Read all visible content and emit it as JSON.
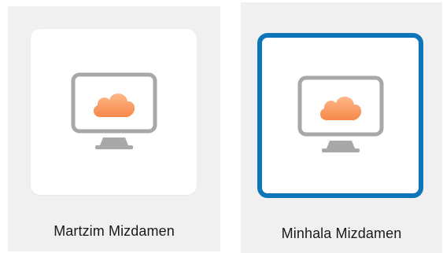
{
  "apps": [
    {
      "name": "Martzim Mizdamen",
      "icon": "cloud-monitor-icon",
      "selected": false
    },
    {
      "name": "Minhala Mizdamen",
      "icon": "cloud-monitor-icon",
      "selected": true
    }
  ],
  "colors": {
    "tile_background": "#f0f0f0",
    "card_background": "#ffffff",
    "selection_border": "#0e75b8",
    "monitor_outline": "#a8a8a8",
    "cloud_light": "#ffc79e",
    "cloud_dark": "#f58a4a"
  }
}
